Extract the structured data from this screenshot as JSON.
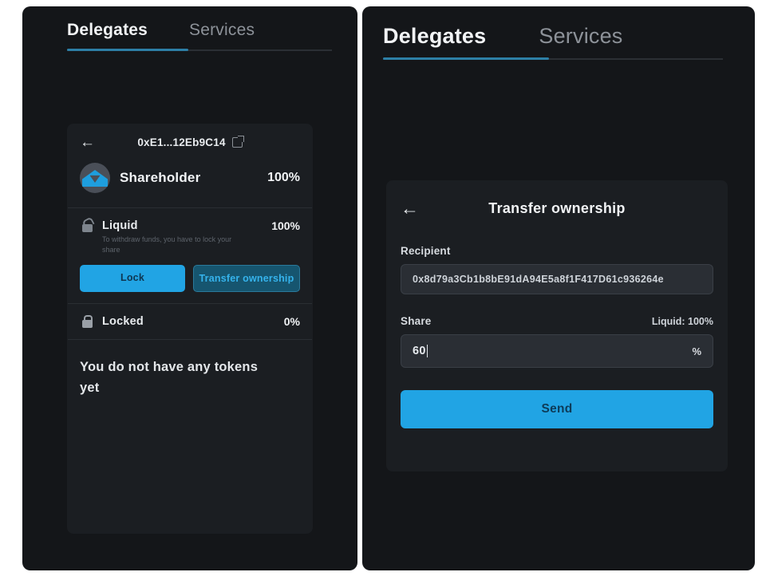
{
  "left_panel": {
    "tabs": [
      {
        "label": "Delegates",
        "active": true
      },
      {
        "label": "Services",
        "active": false
      }
    ],
    "card": {
      "back_icon": "←",
      "address": "0xE1...12Eb9C14",
      "external_link_icon": "external-link-icon",
      "shareholder": {
        "name": "Shareholder",
        "percent": "100%"
      },
      "liquid": {
        "icon": "unlocked-padlock-icon",
        "title": "Liquid",
        "percent": "100%",
        "description": "To withdraw funds, you have to lock your share",
        "lock_button": "Lock",
        "transfer_button": "Transfer ownership"
      },
      "locked": {
        "icon": "padlock-icon",
        "title": "Locked",
        "percent": "0%"
      },
      "empty_state": "You do not have any tokens yet"
    }
  },
  "right_panel": {
    "tabs": [
      {
        "label": "Delegates",
        "active": true
      },
      {
        "label": "Services",
        "active": false
      }
    ],
    "card": {
      "back_icon": "←",
      "title": "Transfer ownership",
      "recipient_label": "Recipient",
      "recipient_value": "0x8d79a3Cb1b8bE91dA94E5a8f1F417D61c936264e",
      "share_label": "Share",
      "liquid_hint": "Liquid: 100%",
      "share_value": "60",
      "percent_suffix": "%",
      "send_button": "Send"
    }
  },
  "colors": {
    "page_background": "#ffffff",
    "panel_background": "#141619",
    "card_background": "#1b1e22",
    "accent_blue": "#21a4e4",
    "accent_underline": "#2d7fa6",
    "secondary_button_bg": "#16556f",
    "secondary_button_text": "#35b3ec",
    "primary_button_text": "#0e3550",
    "text_primary": "#f1f3f5",
    "text_muted": "#8d9299",
    "input_background": "#2a2e34"
  }
}
